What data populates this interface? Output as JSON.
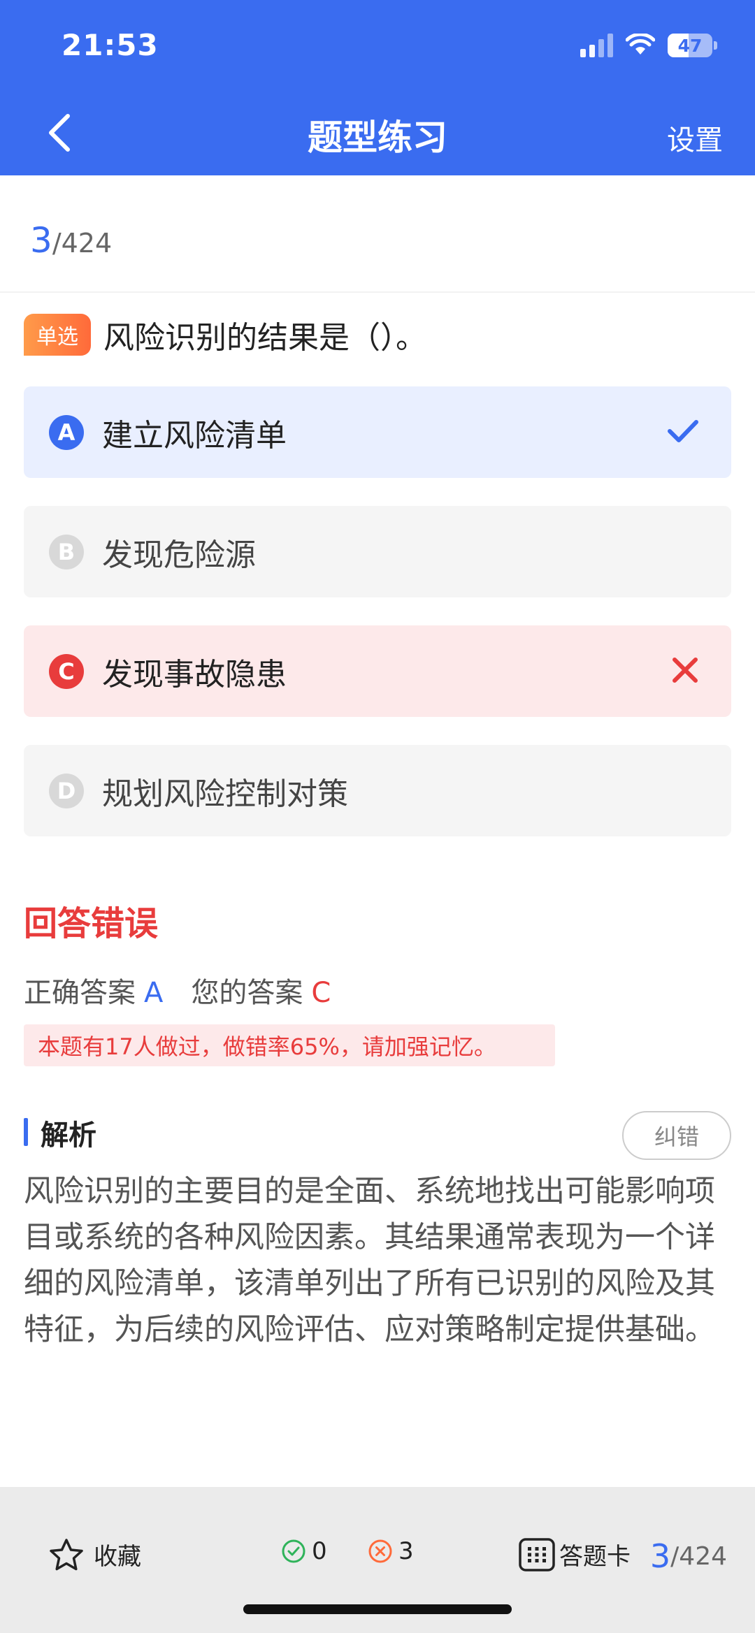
{
  "status_bar": {
    "time": "21:53",
    "battery": "47"
  },
  "nav": {
    "title": "题型练习",
    "settings_label": "设置"
  },
  "progress": {
    "current": "3",
    "total": "/424"
  },
  "question": {
    "type_badge": "单选",
    "text": "风险识别的结果是（）。",
    "options": [
      {
        "letter": "A",
        "label": "建立风险清单",
        "state": "correct"
      },
      {
        "letter": "B",
        "label": "发现危险源",
        "state": "normal"
      },
      {
        "letter": "C",
        "label": "发现事故隐患",
        "state": "wrong"
      },
      {
        "letter": "D",
        "label": "规划风险控制对策",
        "state": "normal"
      }
    ]
  },
  "result": {
    "title": "回答错误",
    "correct_label": "正确答案",
    "correct_value": "A",
    "yours_label": "您的答案",
    "yours_value": "C",
    "hint": "本题有17人做过，做错率65%，请加强记忆。"
  },
  "analysis": {
    "title": "解析",
    "report_button": "纠错",
    "text": "风险识别的主要目的是全面、系统地找出可能影响项目或系统的各种风险因素。其结果通常表现为一个详细的风险清单，该清单列出了所有已识别的风险及其特征，为后续的风险评估、应对策略制定提供基础。"
  },
  "bottom_bar": {
    "favorite_label": "收藏",
    "right_count": "0",
    "wrong_count": "3",
    "answer_card_label": "答题卡",
    "progress_current": "3",
    "progress_total": "/424"
  },
  "colors": {
    "primary": "#3a6cf0",
    "error": "#e83c3c",
    "success": "#2fb35a",
    "badge": "#ff7a3a"
  }
}
